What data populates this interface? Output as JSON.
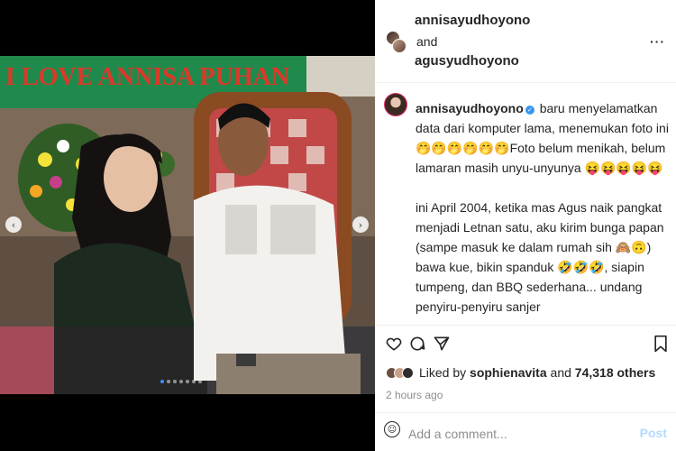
{
  "colors": {
    "accent": "#0095f6",
    "verified": "#3897f0",
    "post_disabled": "#b3dbff",
    "muted": "#8e8e8e"
  },
  "media": {
    "banner_text": "I LOVE   ANNISA PUHAN",
    "carousel": {
      "slides": 7,
      "active": 0
    }
  },
  "header": {
    "author": "annisayudhoyono",
    "connector": "and",
    "coauthor": "agusyudhoyono",
    "more_icon": "more-horizontal-icon",
    "more_label": "···"
  },
  "caption": {
    "username": "annisayudhoyono",
    "line1": "baru menyelamatkan data dari komputer lama, menemukan foto ini 🤭🤭🤭🤭🤭🤭Foto belum menikah, belum lamaran masih unyu-unyunya 😝😝😝😝😝",
    "line2": "ini April 2004, ketika mas Agus naik pangkat menjadi Letnan satu, aku kirim bunga papan (sampe masuk ke dalam rumah sih 🙈🙃) bawa kue, bikin spanduk 🤣🤣🤣, siapin tumpeng, dan BBQ sederhana... undang penyiru-penyiru sanjer"
  },
  "actions": {
    "like_icon": "heart-icon",
    "comment_icon": "comment-icon",
    "share_icon": "send-icon",
    "save_icon": "bookmark-icon"
  },
  "likes": {
    "prefix": "Liked by",
    "first_user": "sophienavita",
    "and": "and",
    "count": "74,318 others"
  },
  "timestamp": "2 hours ago",
  "comment": {
    "placeholder": "Add a comment...",
    "emoji_icon": "emoji-icon",
    "post_label": "Post"
  }
}
